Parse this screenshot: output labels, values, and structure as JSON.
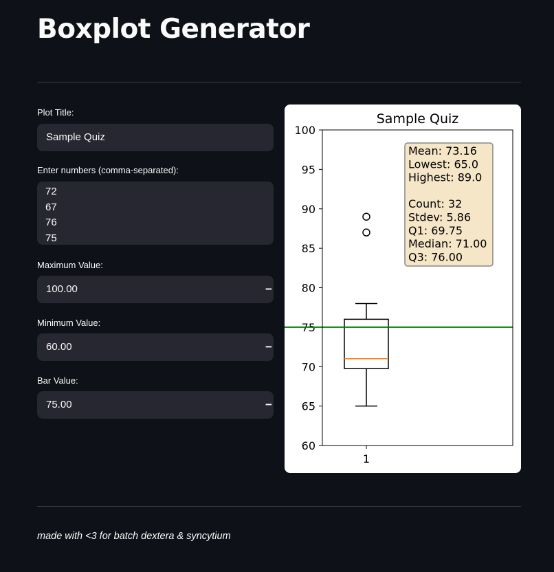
{
  "app": {
    "title": "Boxplot Generator",
    "footer": "made with <3 for batch dextera & syncytium"
  },
  "form": {
    "plot_title_label": "Plot Title:",
    "plot_title_value": "Sample Quiz",
    "numbers_label": "Enter numbers (comma-separated):",
    "numbers_lines": [
      "72",
      "67",
      "76",
      "75"
    ],
    "max_label": "Maximum Value:",
    "max_value": "100.00",
    "min_label": "Minimum Value:",
    "min_value": "60.00",
    "bar_label": "Bar Value:",
    "bar_value": "75.00",
    "decrement_symbol": "−",
    "increment_symbol": "+"
  },
  "chart_data": {
    "type": "boxplot",
    "title": "Sample Quiz",
    "categories": [
      "1"
    ],
    "ylim": [
      60,
      100
    ],
    "yticks": [
      "60",
      "65",
      "70",
      "75",
      "80",
      "85",
      "90",
      "95",
      "100"
    ],
    "box": {
      "whisker_low": 65,
      "q1": 69.75,
      "median": 71,
      "q3": 76,
      "whisker_high": 78,
      "outliers": [
        87,
        89
      ]
    },
    "reference_line": {
      "value": 75,
      "color": "#008000"
    },
    "median_color": "#ff7f0e",
    "stats_lines": [
      "Mean: 73.16",
      "Lowest: 65.0",
      "Highest: 89.0",
      "",
      "Count: 32",
      "Stdev: 5.86",
      "Q1: 69.75",
      "Median: 71.00",
      "Q3: 76.00"
    ],
    "stats_box_fill": "#f5e6c8"
  }
}
